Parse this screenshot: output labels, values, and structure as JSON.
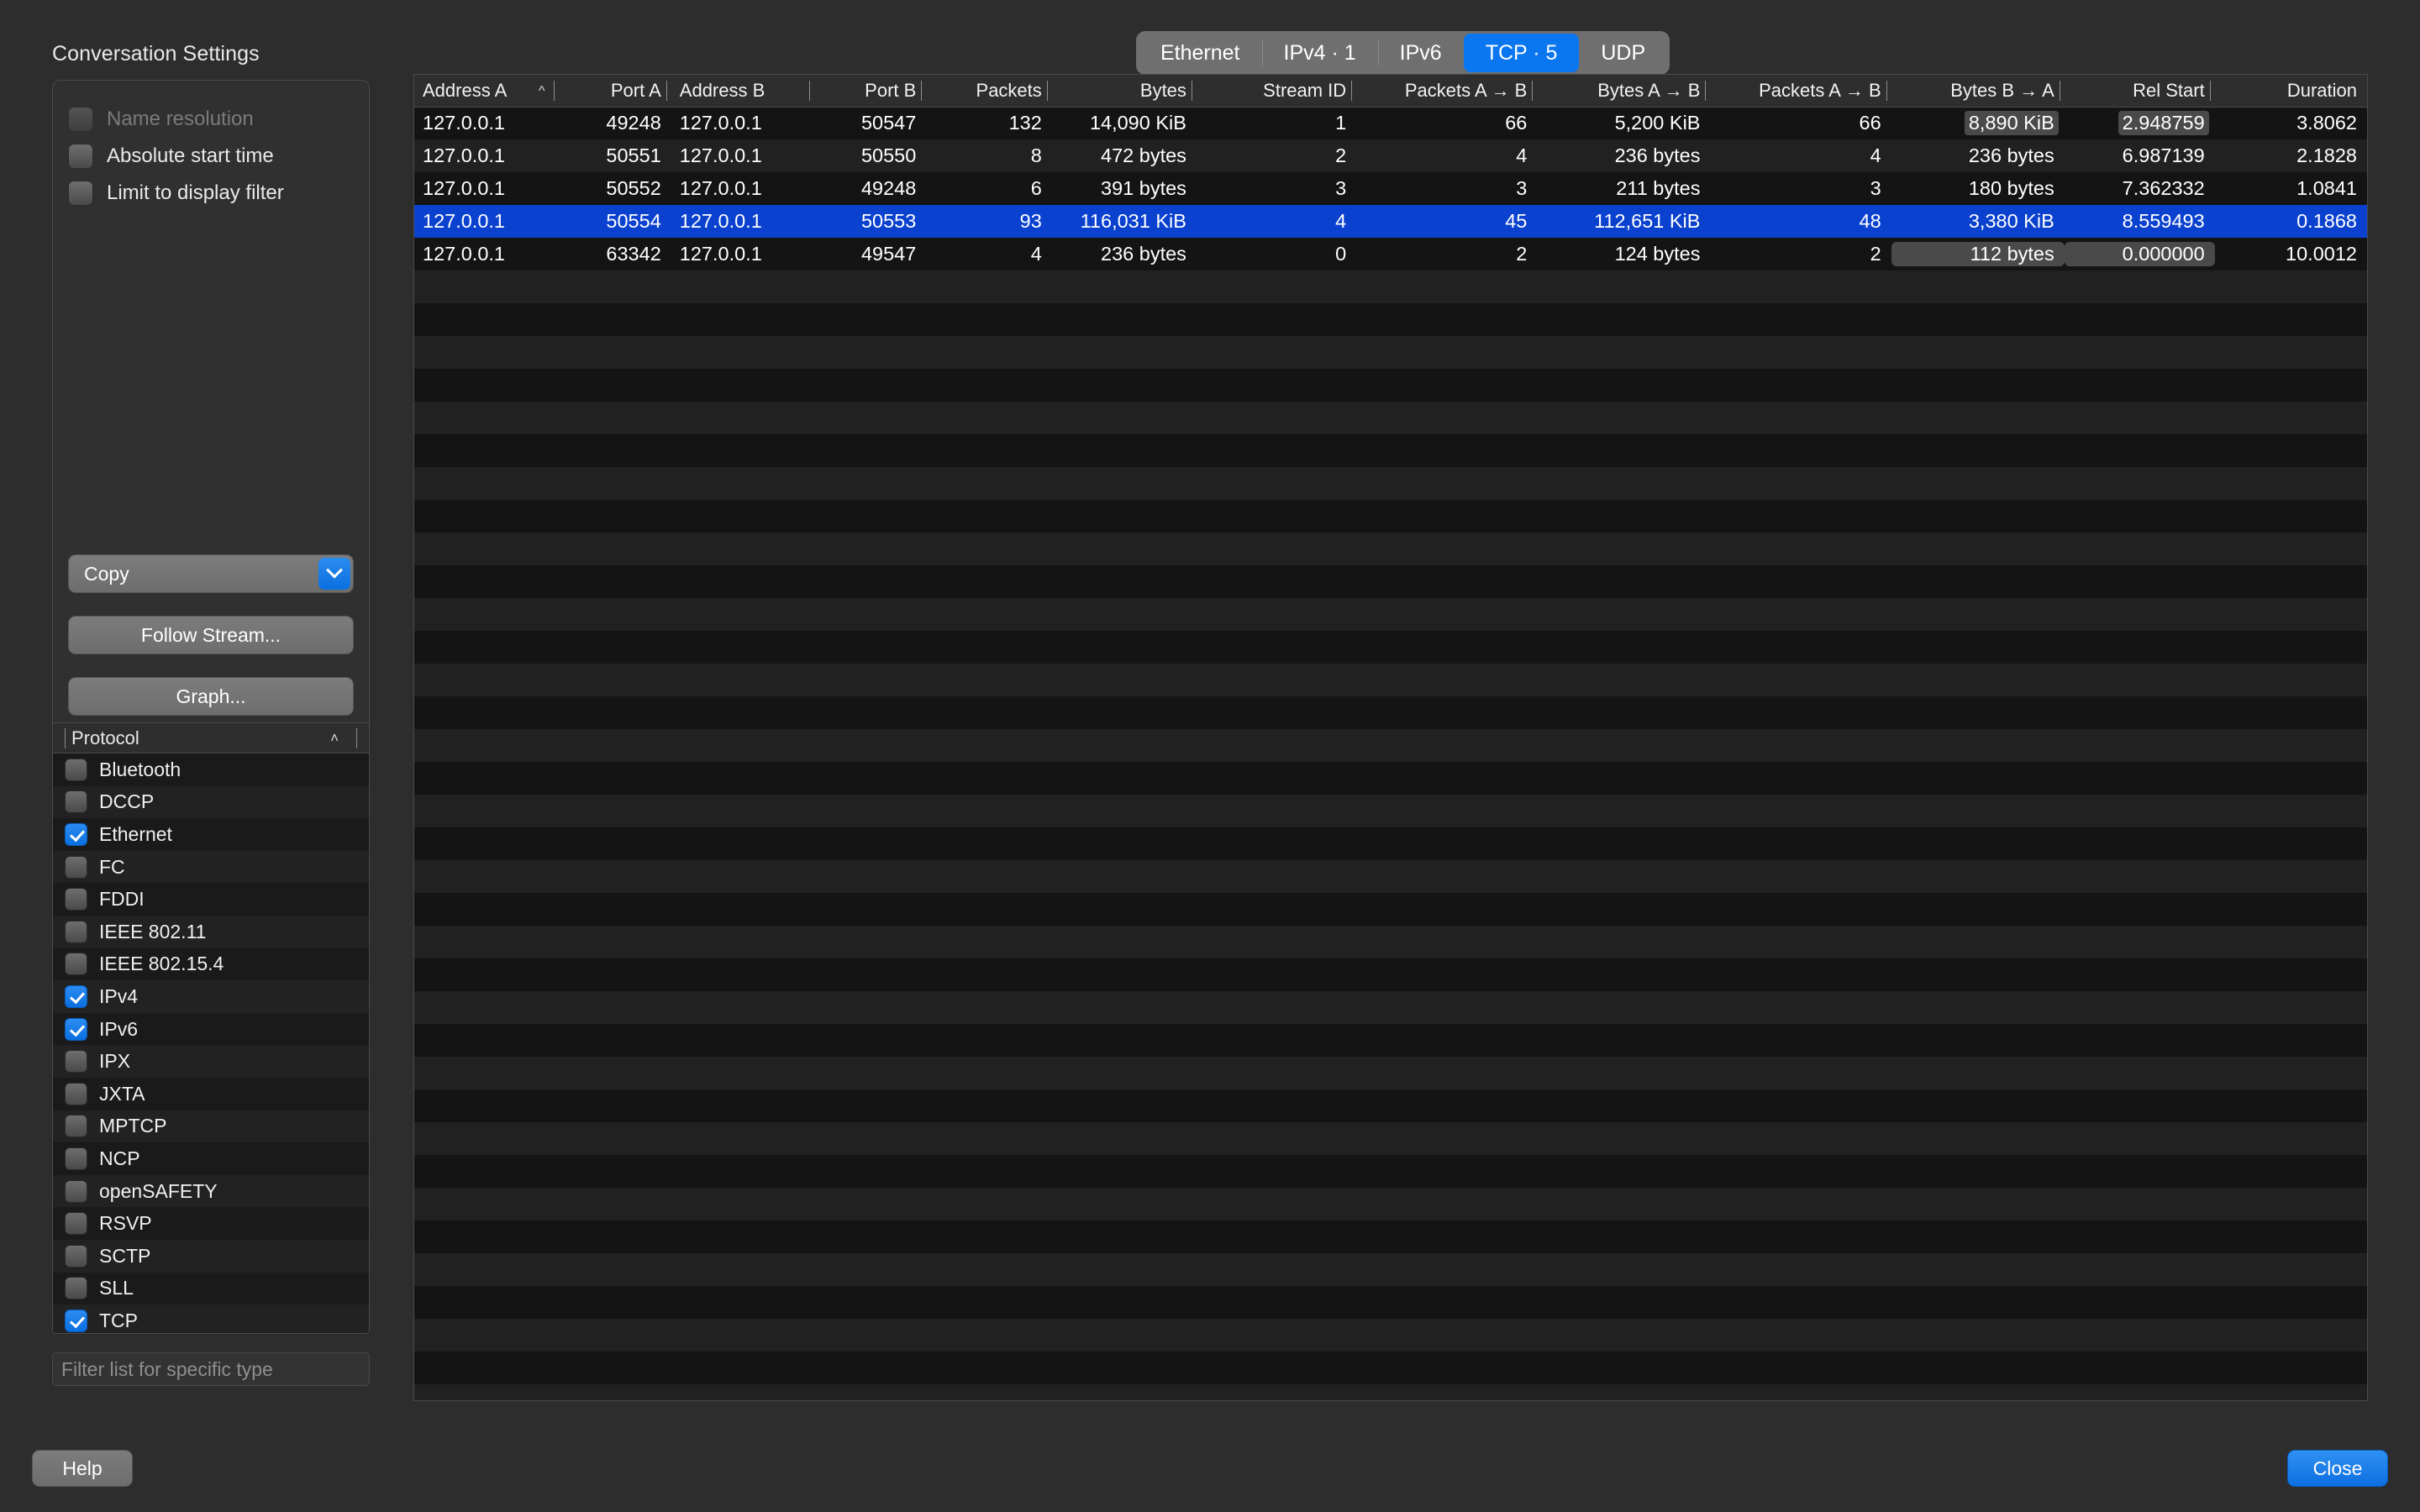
{
  "sidebar": {
    "section_title": "Conversation Settings",
    "checkboxes": [
      {
        "label": "Name resolution",
        "checked": false,
        "disabled": true
      },
      {
        "label": "Absolute start time",
        "checked": false,
        "disabled": false
      },
      {
        "label": "Limit to display filter",
        "checked": false,
        "disabled": false
      }
    ],
    "copy_label": "Copy",
    "follow_stream_label": "Follow Stream...",
    "graph_label": "Graph..."
  },
  "protocol_panel": {
    "header": "Protocol",
    "sort_caret": "˄",
    "filter_placeholder": "Filter list for specific type",
    "items": [
      {
        "label": "Bluetooth",
        "checked": false
      },
      {
        "label": "DCCP",
        "checked": false
      },
      {
        "label": "Ethernet",
        "checked": true
      },
      {
        "label": "FC",
        "checked": false
      },
      {
        "label": "FDDI",
        "checked": false
      },
      {
        "label": "IEEE 802.11",
        "checked": false
      },
      {
        "label": "IEEE 802.15.4",
        "checked": false
      },
      {
        "label": "IPv4",
        "checked": true
      },
      {
        "label": "IPv6",
        "checked": true
      },
      {
        "label": "IPX",
        "checked": false
      },
      {
        "label": "JXTA",
        "checked": false
      },
      {
        "label": "MPTCP",
        "checked": false
      },
      {
        "label": "NCP",
        "checked": false
      },
      {
        "label": "openSAFETY",
        "checked": false
      },
      {
        "label": "RSVP",
        "checked": false
      },
      {
        "label": "SCTP",
        "checked": false
      },
      {
        "label": "SLL",
        "checked": false
      },
      {
        "label": "TCP",
        "checked": true
      }
    ]
  },
  "tabs": [
    {
      "label": "Ethernet",
      "active": false
    },
    {
      "label": "IPv4 · 1",
      "active": false
    },
    {
      "label": "IPv6",
      "active": false
    },
    {
      "label": "TCP · 5",
      "active": true
    },
    {
      "label": "UDP",
      "active": false
    }
  ],
  "table": {
    "sorted_column": "Address A",
    "sort_direction": "ascending",
    "columns": [
      "Address A",
      "Port A",
      "Address B",
      "Port B",
      "Packets",
      "Bytes",
      "Stream ID",
      "Packets A → B",
      "Bytes A → B",
      "Packets A → B",
      "Bytes B → A",
      "Rel Start",
      "Duration"
    ],
    "rows": [
      {
        "selected": false,
        "address_a": "127.0.0.1",
        "port_a": "49248",
        "address_b": "127.0.0.1",
        "port_b": "50547",
        "packets": "132",
        "bytes": "14,090 KiB",
        "stream_id": "1",
        "packets_ab": "66",
        "bytes_ab": "5,200 KiB",
        "packets_ba": "66",
        "bytes_ba": "8,890 KiB",
        "rel_start": "2.948759",
        "duration": "3.8062"
      },
      {
        "selected": false,
        "address_a": "127.0.0.1",
        "port_a": "50551",
        "address_b": "127.0.0.1",
        "port_b": "50550",
        "packets": "8",
        "bytes": "472 bytes",
        "stream_id": "2",
        "packets_ab": "4",
        "bytes_ab": "236 bytes",
        "packets_ba": "4",
        "bytes_ba": "236 bytes",
        "rel_start": "6.987139",
        "duration": "2.1828"
      },
      {
        "selected": false,
        "address_a": "127.0.0.1",
        "port_a": "50552",
        "address_b": "127.0.0.1",
        "port_b": "49248",
        "packets": "6",
        "bytes": "391 bytes",
        "stream_id": "3",
        "packets_ab": "3",
        "bytes_ab": "211 bytes",
        "packets_ba": "3",
        "bytes_ba": "180 bytes",
        "rel_start": "7.362332",
        "duration": "1.0841"
      },
      {
        "selected": true,
        "address_a": "127.0.0.1",
        "port_a": "50554",
        "address_b": "127.0.0.1",
        "port_b": "50553",
        "packets": "93",
        "bytes": "116,031 KiB",
        "stream_id": "4",
        "packets_ab": "45",
        "bytes_ab": "112,651 KiB",
        "packets_ba": "48",
        "bytes_ba": "3,380 KiB",
        "rel_start": "8.559493",
        "duration": "0.1868"
      },
      {
        "selected": false,
        "address_a": "127.0.0.1",
        "port_a": "63342",
        "address_b": "127.0.0.1",
        "port_b": "49547",
        "packets": "4",
        "bytes": "236 bytes",
        "stream_id": "0",
        "packets_ab": "2",
        "bytes_ab": "124 bytes",
        "packets_ba": "2",
        "bytes_ba": "112 bytes",
        "rel_start": "0.000000",
        "duration": "10.0012"
      }
    ]
  },
  "footer": {
    "help_label": "Help",
    "close_label": "Close"
  },
  "colors": {
    "accent_blue": "#0a76f0",
    "selection_blue": "#0b41cf",
    "window_bg": "#2d2d2d",
    "table_bg": "#1a1a1a"
  }
}
